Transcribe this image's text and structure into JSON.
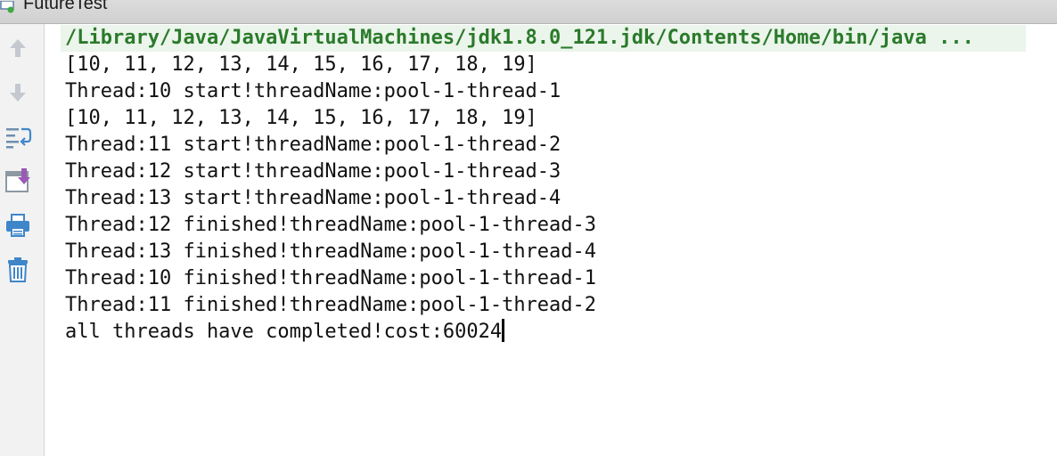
{
  "run_tab": {
    "title": "FutureTest",
    "icon": "run-config-icon"
  },
  "toolbar": {
    "buttons": [
      {
        "icon": "arrow-up-icon"
      },
      {
        "icon": "arrow-down-icon"
      },
      {
        "icon": "soft-wrap-icon"
      },
      {
        "icon": "scroll-to-end-icon"
      },
      {
        "icon": "print-icon"
      },
      {
        "icon": "trash-icon"
      }
    ]
  },
  "console": {
    "command": "/Library/Java/JavaVirtualMachines/jdk1.8.0_121.jdk/Contents/Home/bin/java ...",
    "lines": [
      "[10, 11, 12, 13, 14, 15, 16, 17, 18, 19]",
      "Thread:10 start!threadName:pool-1-thread-1",
      "[10, 11, 12, 13, 14, 15, 16, 17, 18, 19]",
      "Thread:11 start!threadName:pool-1-thread-2",
      "Thread:12 start!threadName:pool-1-thread-3",
      "Thread:13 start!threadName:pool-1-thread-4",
      "Thread:12 finished!threadName:pool-1-thread-3",
      "Thread:13 finished!threadName:pool-1-thread-4",
      "Thread:10 finished!threadName:pool-1-thread-1",
      "Thread:11 finished!threadName:pool-1-thread-2"
    ],
    "last_line": "all threads have completed!cost:60024"
  },
  "colors": {
    "command_text": "#2b7a2b",
    "command_bg": "#ebf5eb",
    "output_text": "#111111",
    "toolbar_icon": "#9aa7b3",
    "accent_blue": "#3f86c9"
  }
}
